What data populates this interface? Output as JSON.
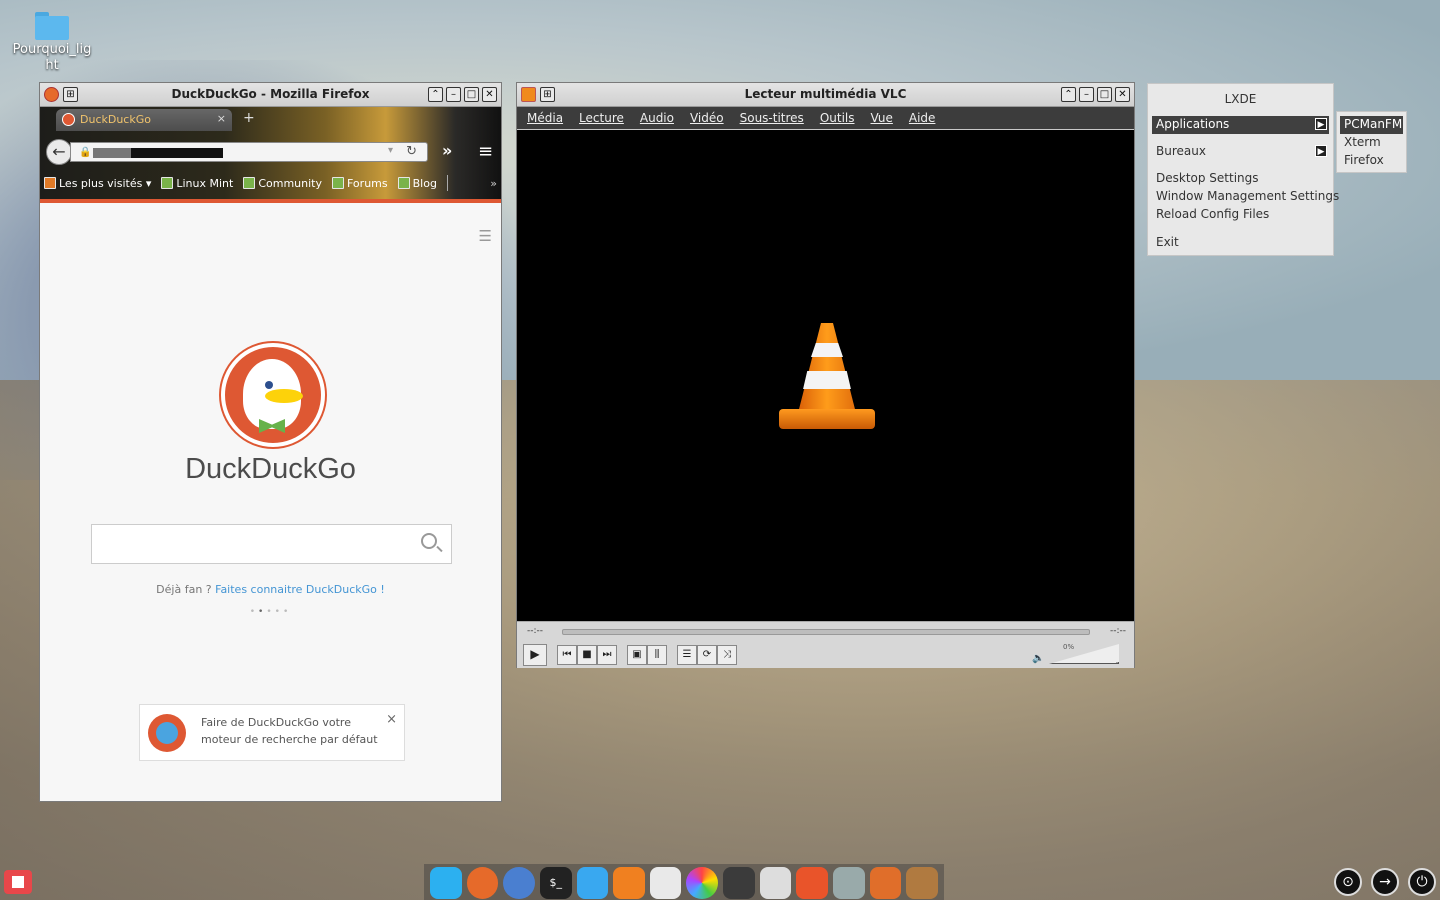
{
  "desktop": {
    "folder_label": "Pourquoi_lig ht"
  },
  "firefox": {
    "window_title": "DuckDuckGo - Mozilla Firefox",
    "tab_label": "DuckDuckGo",
    "tab_close": "×",
    "new_tab": "+",
    "bookmarks": [
      {
        "label": "Les plus visités ▾",
        "icon": "folder-icon"
      },
      {
        "label": "Linux Mint",
        "icon": "mint-icon"
      },
      {
        "label": "Community",
        "icon": "mint-icon"
      },
      {
        "label": "Forums",
        "icon": "mint-icon"
      },
      {
        "label": "Blog",
        "icon": "mint-icon"
      }
    ],
    "page": {
      "brand": "DuckDuckGo",
      "search_placeholder": "",
      "fan_text": "Déjà fan ?",
      "fan_link": "Faites connaitre DuckDuckGo !",
      "promo_text": "Faire de DuckDuckGo votre moteur de recherche par défaut",
      "promo_close": "×"
    },
    "accent": "#de5833"
  },
  "vlc": {
    "window_title": "Lecteur multimédia VLC",
    "menu": [
      "Média",
      "Lecture",
      "Audio",
      "Vidéo",
      "Sous-titres",
      "Outils",
      "Vue",
      "Aide"
    ],
    "time_elapsed": "--:--",
    "time_total": "--:--",
    "volume_label": "0%",
    "volume": 0,
    "progress": 0
  },
  "lxde_menu": {
    "header": "LXDE",
    "items": [
      "Applications",
      "Bureaux",
      "Desktop Settings",
      "Window Management Settings",
      "Reload Config Files",
      "Exit"
    ],
    "submenu": [
      "PCManFM",
      "Xterm",
      "Firefox"
    ]
  },
  "taskbar": {
    "dock_icons": [
      "skype-icon",
      "firefox-icon",
      "chromium-icon",
      "terminal-icon",
      "finder-icon",
      "jump-icon",
      "vlc-icon",
      "color-icon",
      "kodi-icon",
      "files-icon",
      "store-icon",
      "settings-icon",
      "gimp-icon",
      "install-icon"
    ],
    "terminal_label": "$_",
    "sys_icons": [
      "lock-icon",
      "logout-icon",
      "power-icon"
    ]
  }
}
